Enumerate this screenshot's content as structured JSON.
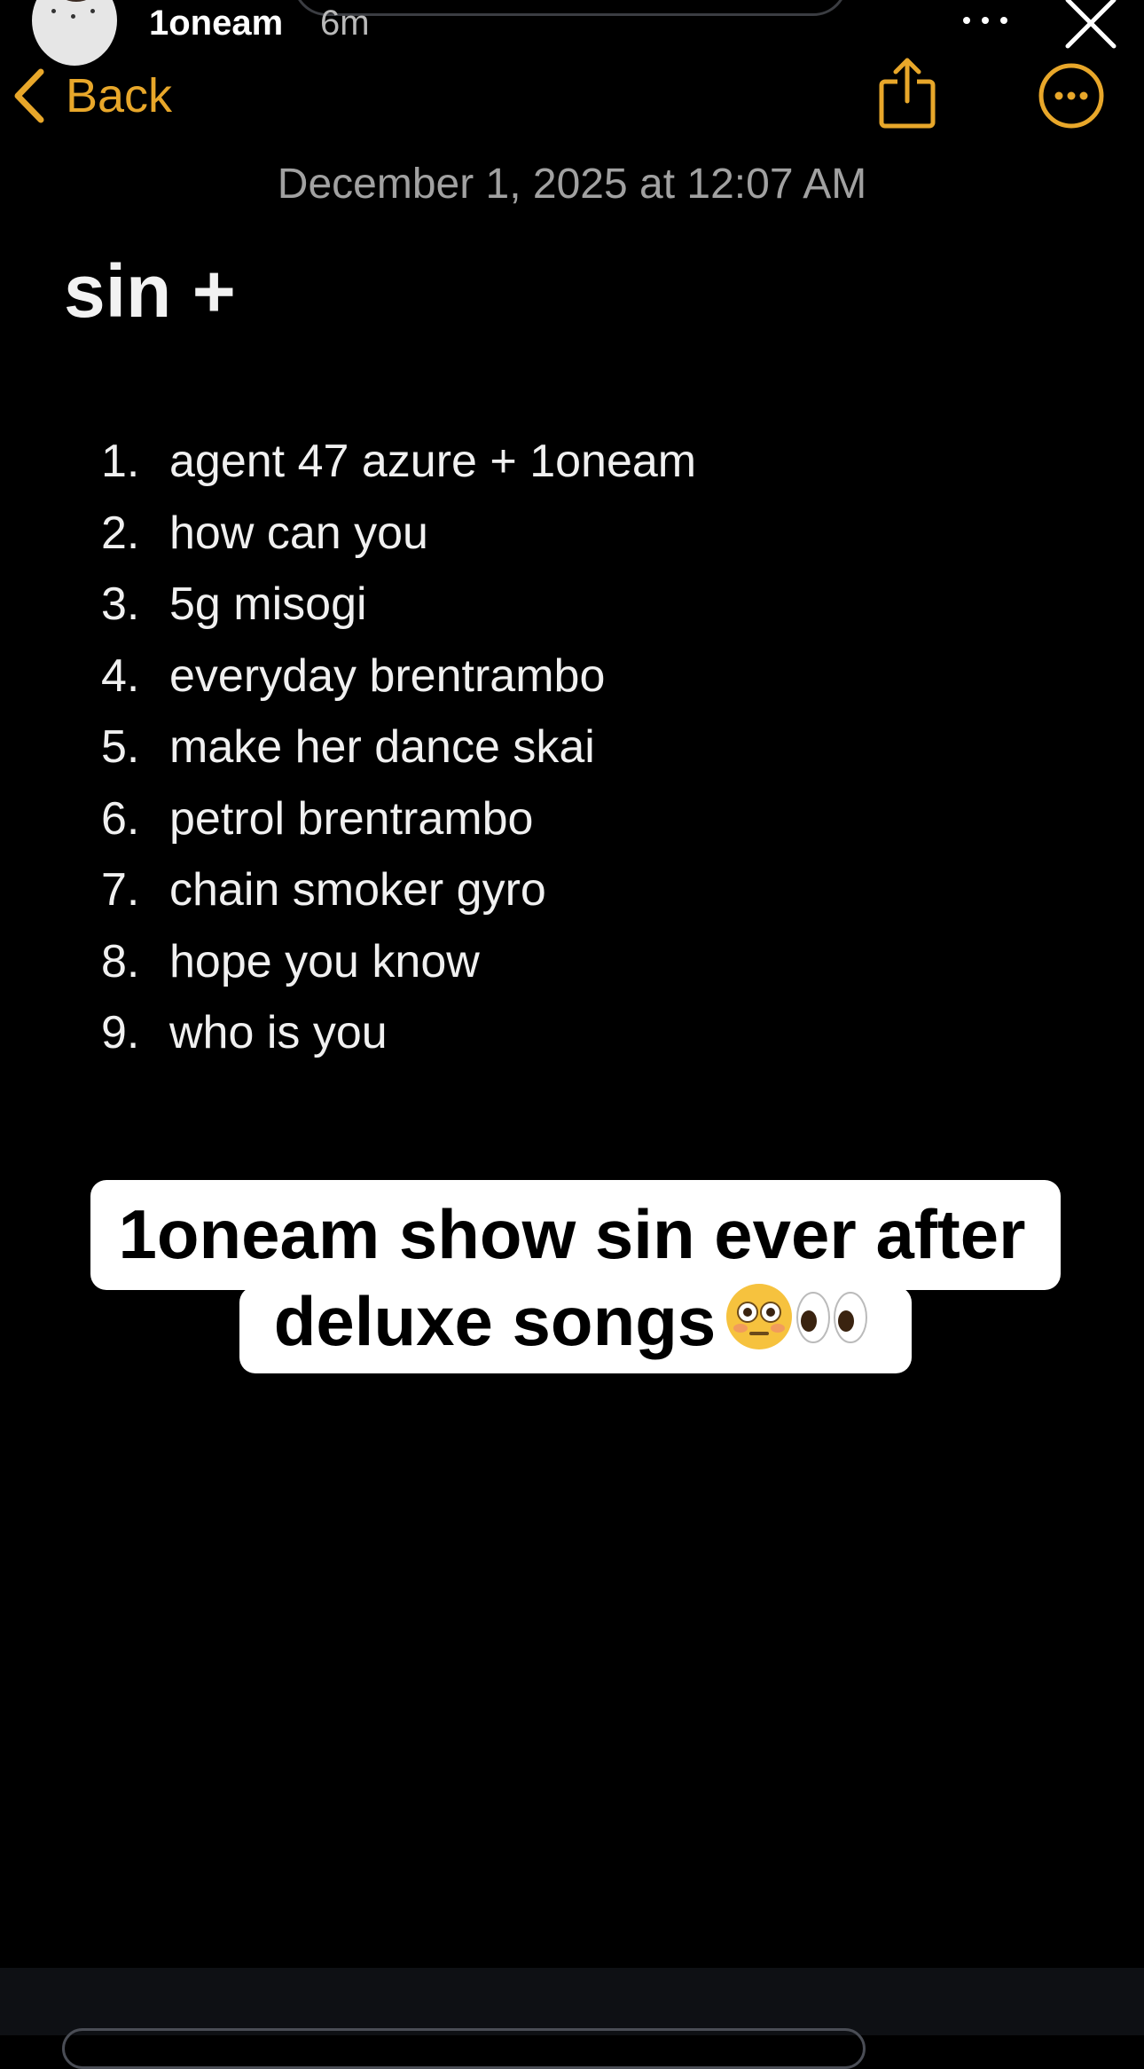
{
  "story": {
    "username": "1oneam",
    "time_ago": "6m",
    "more_icon": "ellipsis-icon",
    "close_icon": "close-icon"
  },
  "note": {
    "back_label": "Back",
    "share_icon": "share-icon",
    "menu_icon": "ellipsis-circle-icon",
    "date": "December 1, 2025 at 12:07 AM",
    "title": "sin +",
    "songs": [
      {
        "num": "1.",
        "text": "agent 47 azure + 1oneam"
      },
      {
        "num": "2.",
        "text": "how can you"
      },
      {
        "num": "3.",
        "text": "5g misogi"
      },
      {
        "num": "4.",
        "text": "everyday brentrambo"
      },
      {
        "num": "5.",
        "text": "make her dance skai"
      },
      {
        "num": "6.",
        "text": "petrol brentrambo"
      },
      {
        "num": "7.",
        "text": "chain smoker gyro"
      },
      {
        "num": "8.",
        "text": "hope you know"
      },
      {
        "num": "9.",
        "text": "who is you"
      }
    ]
  },
  "caption": {
    "line1": "1oneam show sin ever after",
    "line2": "deluxe songs"
  },
  "colors": {
    "accent": "#e8a72a",
    "background": "#000000",
    "text": "#f0f0f0",
    "muted": "#a1a1a1"
  }
}
